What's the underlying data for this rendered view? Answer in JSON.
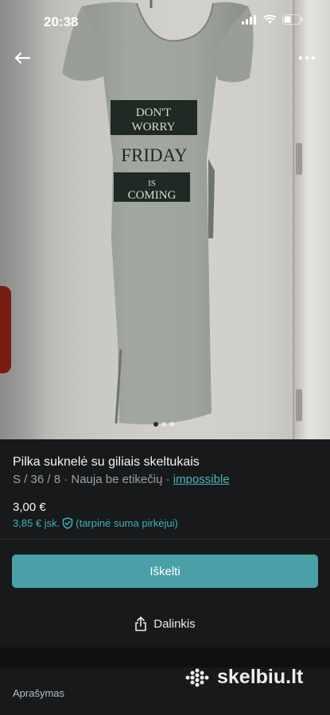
{
  "status_bar": {
    "time": "20:38"
  },
  "header": {
    "back_icon": "arrow-left-icon",
    "more_icon": "more-horizontal-icon"
  },
  "photo": {
    "print_line1": "DON'T",
    "print_line2": "WORRY",
    "print_line3": "FRIDAY",
    "print_line4": "IS",
    "print_line5": "COMING",
    "dots_count": 3,
    "active_dot": 1
  },
  "item": {
    "title": "Pilka suknelė su giliais skeltukais",
    "meta_prefix": "S / 36 / 8 · Nauja be etikečių · ",
    "brand": "impossible",
    "price": "3,00 €",
    "protected_price": "3,85 € įsk.",
    "protected_note": "(tarpinė suma pirkėjui)"
  },
  "actions": {
    "bump_label": "Iškelti",
    "share_label": "Dalinkis"
  },
  "description": {
    "label": "Aprašymas"
  },
  "watermark": {
    "text": "skelbiu.lt"
  },
  "colors": {
    "accent": "#4aa0a6",
    "link": "#49b6be",
    "background": "#17191b"
  }
}
